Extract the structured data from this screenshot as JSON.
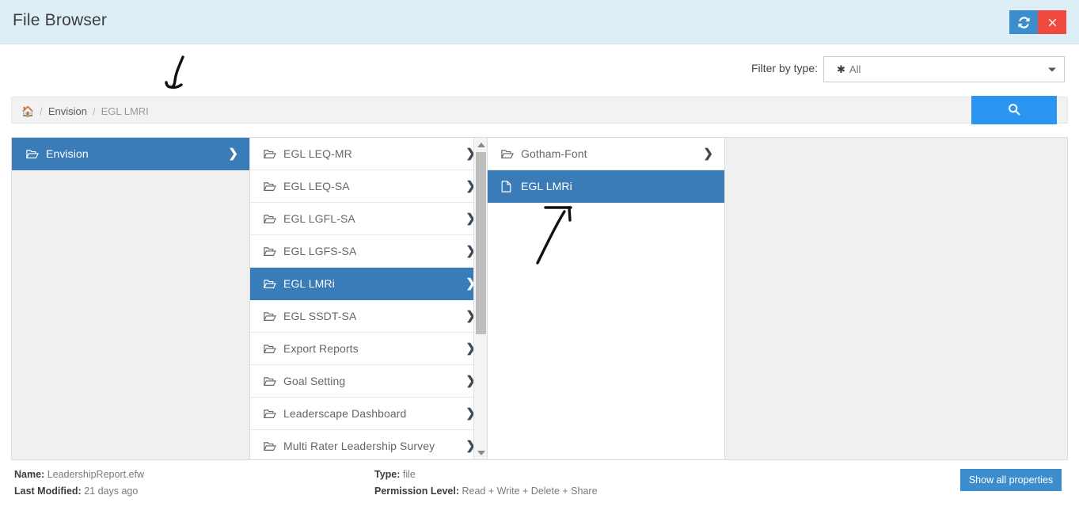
{
  "window": {
    "title": "File Browser",
    "refresh_icon": "refresh-icon",
    "close_icon": "close-icon"
  },
  "filter": {
    "label": "Filter by type:",
    "asterisk_icon": "asterisk-icon",
    "value": "All",
    "options": [
      "All"
    ]
  },
  "breadcrumb": {
    "home_icon": "home-icon",
    "separator": "/",
    "items": [
      {
        "label": "Envision",
        "current": false
      },
      {
        "label": "EGL LMRI",
        "current": true
      }
    ]
  },
  "search": {
    "icon": "search-icon"
  },
  "columns": [
    {
      "name": "column-1",
      "items": [
        {
          "label": "Envision",
          "icon": "folder-icon",
          "chevron": true,
          "selected": true
        }
      ]
    },
    {
      "name": "column-2",
      "scrollable": true,
      "items": [
        {
          "label": "EGL LEQ-MR",
          "icon": "folder-icon",
          "chevron": true,
          "selected": false
        },
        {
          "label": "EGL LEQ-SA",
          "icon": "folder-icon",
          "chevron": true,
          "selected": false
        },
        {
          "label": "EGL LGFL-SA",
          "icon": "folder-icon",
          "chevron": true,
          "selected": false
        },
        {
          "label": "EGL LGFS-SA",
          "icon": "folder-icon",
          "chevron": true,
          "selected": false
        },
        {
          "label": "EGL LMRi",
          "icon": "folder-icon",
          "chevron": true,
          "selected": true
        },
        {
          "label": "EGL SSDT-SA",
          "icon": "folder-icon",
          "chevron": true,
          "selected": false
        },
        {
          "label": "Export Reports",
          "icon": "folder-icon",
          "chevron": true,
          "selected": false
        },
        {
          "label": "Goal Setting",
          "icon": "folder-icon",
          "chevron": true,
          "selected": false
        },
        {
          "label": "Leaderscape Dashboard",
          "icon": "folder-icon",
          "chevron": true,
          "selected": false
        },
        {
          "label": "Multi Rater Leadership Survey",
          "icon": "folder-icon",
          "chevron": true,
          "selected": false
        }
      ]
    },
    {
      "name": "column-3",
      "items": [
        {
          "label": "Gotham-Font",
          "icon": "folder-icon",
          "chevron": true,
          "selected": false
        },
        {
          "label": "EGL LMRi",
          "icon": "file-icon",
          "chevron": false,
          "selected": true
        }
      ]
    },
    {
      "name": "column-4",
      "items": []
    }
  ],
  "details": {
    "name_key": "Name:",
    "name_value": "LeadershipReport.efw",
    "modified_key": "Last Modified:",
    "modified_value": "21 days ago",
    "type_key": "Type:",
    "type_value": "file",
    "permission_key": "Permission Level:",
    "permission_value": "Read + Write + Delete + Share",
    "show_all_properties": "Show all properties"
  },
  "colors": {
    "titlebar_bg": "#deeef7",
    "selected_blue": "#3a7cb8",
    "refresh_blue": "#3c8dcd",
    "close_red": "#f04a3f",
    "search_blue": "#2a96f2",
    "panel_grey": "#f0f0f0"
  },
  "annotations": [
    {
      "name": "handdrawn-hook-mark",
      "shape": "downward-hook-stroke"
    },
    {
      "name": "handdrawn-arrow-mark",
      "shape": "arrow-pointing-up-right"
    }
  ]
}
